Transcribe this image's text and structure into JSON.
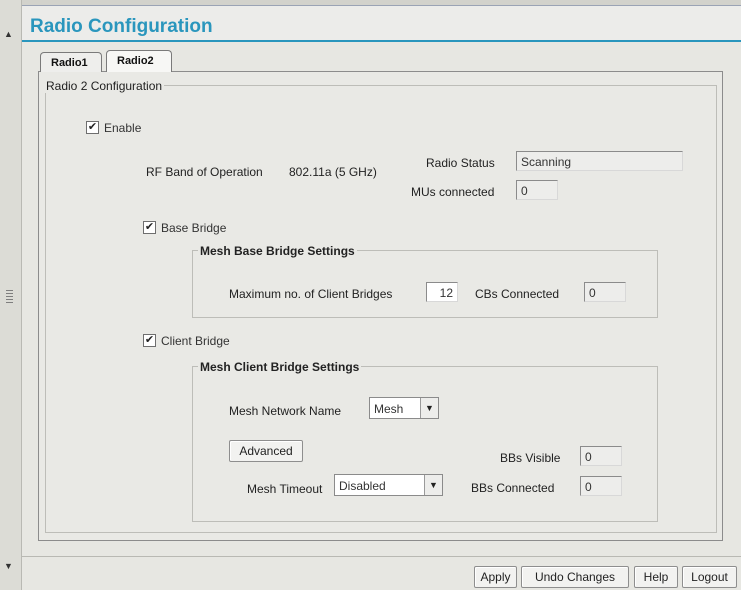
{
  "title": "Radio Configuration",
  "tabs": [
    {
      "label": "Radio1"
    },
    {
      "label": "Radio2"
    }
  ],
  "radio_group_title": "Radio 2 Configuration",
  "enable": {
    "label": "Enable",
    "checked": true
  },
  "rf_band": {
    "label": "RF Band of Operation",
    "value": "802.11a (5 GHz)"
  },
  "radio_status": {
    "label": "Radio Status",
    "value": "Scanning"
  },
  "mus_connected": {
    "label": "MUs connected",
    "value": "0"
  },
  "base_bridge": {
    "label": "Base Bridge",
    "checked": true,
    "group_title": "Mesh Base Bridge Settings",
    "max_clients_label": "Maximum no. of Client Bridges",
    "max_clients_value": "12",
    "cbs_connected_label": "CBs Connected",
    "cbs_connected_value": "0"
  },
  "client_bridge": {
    "label": "Client Bridge",
    "checked": true,
    "group_title": "Mesh Client Bridge Settings",
    "network_name_label": "Mesh Network Name",
    "network_name_value": "Mesh",
    "advanced_label": "Advanced",
    "timeout_label": "Mesh Timeout",
    "timeout_value": "Disabled",
    "bbs_visible_label": "BBs Visible",
    "bbs_visible_value": "0",
    "bbs_connected_label": "BBs Connected",
    "bbs_connected_value": "0"
  },
  "buttons": {
    "apply": "Apply",
    "undo": "Undo Changes",
    "help": "Help",
    "logout": "Logout"
  },
  "icons": {
    "check": "✔",
    "dropdown": "▼",
    "scroll_up": "▲",
    "scroll_down": "▼"
  },
  "colors": {
    "title": "#2a96bd",
    "background": "#e7e7e2"
  }
}
